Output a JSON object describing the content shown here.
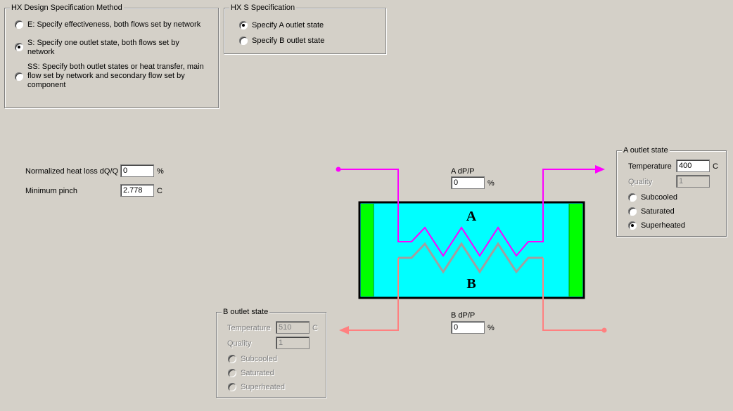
{
  "design_method": {
    "title": "HX Design Specification Method",
    "options": [
      {
        "label": "E: Specify effectiveness, both flows set by network",
        "checked": false
      },
      {
        "label": "S:  Specify one outlet state, both flows set by network",
        "checked": true
      },
      {
        "label": "SS: Specify both outlet states or heat transfer,  main flow set by network and secondary flow set by component",
        "checked": false
      }
    ]
  },
  "s_spec": {
    "title": "HX S Specification",
    "options": [
      {
        "label": "Specify A outlet state",
        "checked": true
      },
      {
        "label": "Specify B outlet state",
        "checked": false
      }
    ]
  },
  "heat_loss": {
    "label": "Normalized heat loss dQ/Q",
    "value": "0",
    "unit": "%"
  },
  "min_pinch": {
    "label": "Minimum pinch",
    "value": "2.778",
    "unit": "C"
  },
  "a_dpp": {
    "label": "A dP/P",
    "value": "0",
    "unit": "%"
  },
  "b_dpp": {
    "label": "B dP/P",
    "value": "0",
    "unit": "%"
  },
  "diagram": {
    "label_a": "A",
    "label_b": "B",
    "colors": {
      "a_line": "#ff00ff",
      "b_line": "#ff8080",
      "coil_b": "#a0a0a0",
      "body": "#00ffff",
      "ends": "#00ff00"
    }
  },
  "a_outlet": {
    "title": "A outlet state",
    "temperature_label": "Temperature",
    "temperature": "400",
    "temperature_unit": "C",
    "quality_label": "Quality",
    "quality": "1",
    "options": [
      {
        "label": "Subcooled",
        "checked": false
      },
      {
        "label": "Saturated",
        "checked": false
      },
      {
        "label": "Superheated",
        "checked": true
      }
    ]
  },
  "b_outlet": {
    "title": "B outlet state",
    "temperature_label": "Temperature",
    "temperature": "510",
    "temperature_unit": "C",
    "quality_label": "Quality",
    "quality": "1",
    "options": [
      {
        "label": "Subcooled",
        "checked": false
      },
      {
        "label": "Saturated",
        "checked": false
      },
      {
        "label": "Superheated",
        "checked": false
      }
    ]
  }
}
